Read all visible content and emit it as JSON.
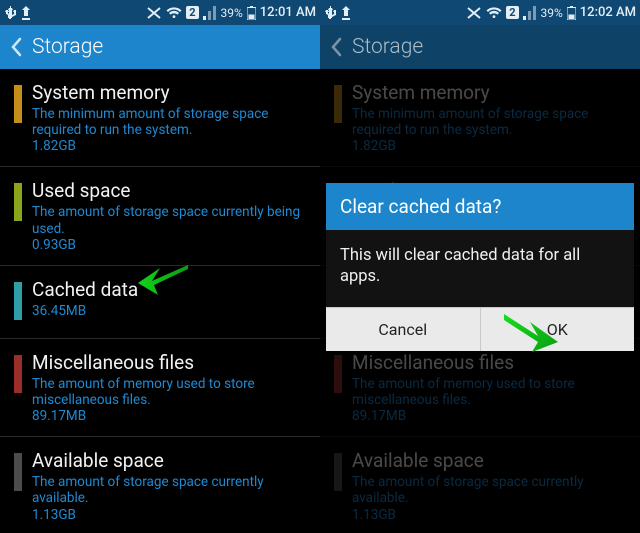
{
  "status": {
    "left_time": "12:01 AM",
    "right_time": "12:02 AM",
    "battery_pct": "39%",
    "badge_num": "2"
  },
  "actionbar": {
    "title": "Storage"
  },
  "colors": {
    "system": "#c58e18",
    "used": "#8aa51a",
    "cached": "#2e9fa6",
    "misc": "#9a2f2a",
    "avail": "#4c4c4c",
    "link": "#1f8ad4",
    "abar": "#1d85cb",
    "sbar": "#0f4872"
  },
  "items": [
    {
      "id": "system",
      "title": "System memory",
      "desc": "The minimum amount of storage space required to run the system.",
      "size": "1.82GB"
    },
    {
      "id": "used",
      "title": "Used space",
      "desc": "The amount of storage space currently being used.",
      "size": "0.93GB",
      "swatch": true
    },
    {
      "id": "cached",
      "title": "Cached data",
      "desc": "",
      "size": "36.45MB",
      "swatch": true
    },
    {
      "id": "misc",
      "title": "Miscellaneous files",
      "desc": "The amount of memory used to store miscellaneous files.",
      "size": "89.17MB",
      "swatch": true
    },
    {
      "id": "avail",
      "title": "Available space",
      "desc": "The amount of storage space currently available.",
      "size": "1.13GB",
      "swatch": true
    }
  ],
  "item_system_swatch": true,
  "dialog": {
    "title": "Clear cached data?",
    "body": "This will clear cached data for all apps.",
    "cancel": "Cancel",
    "ok": "OK"
  }
}
